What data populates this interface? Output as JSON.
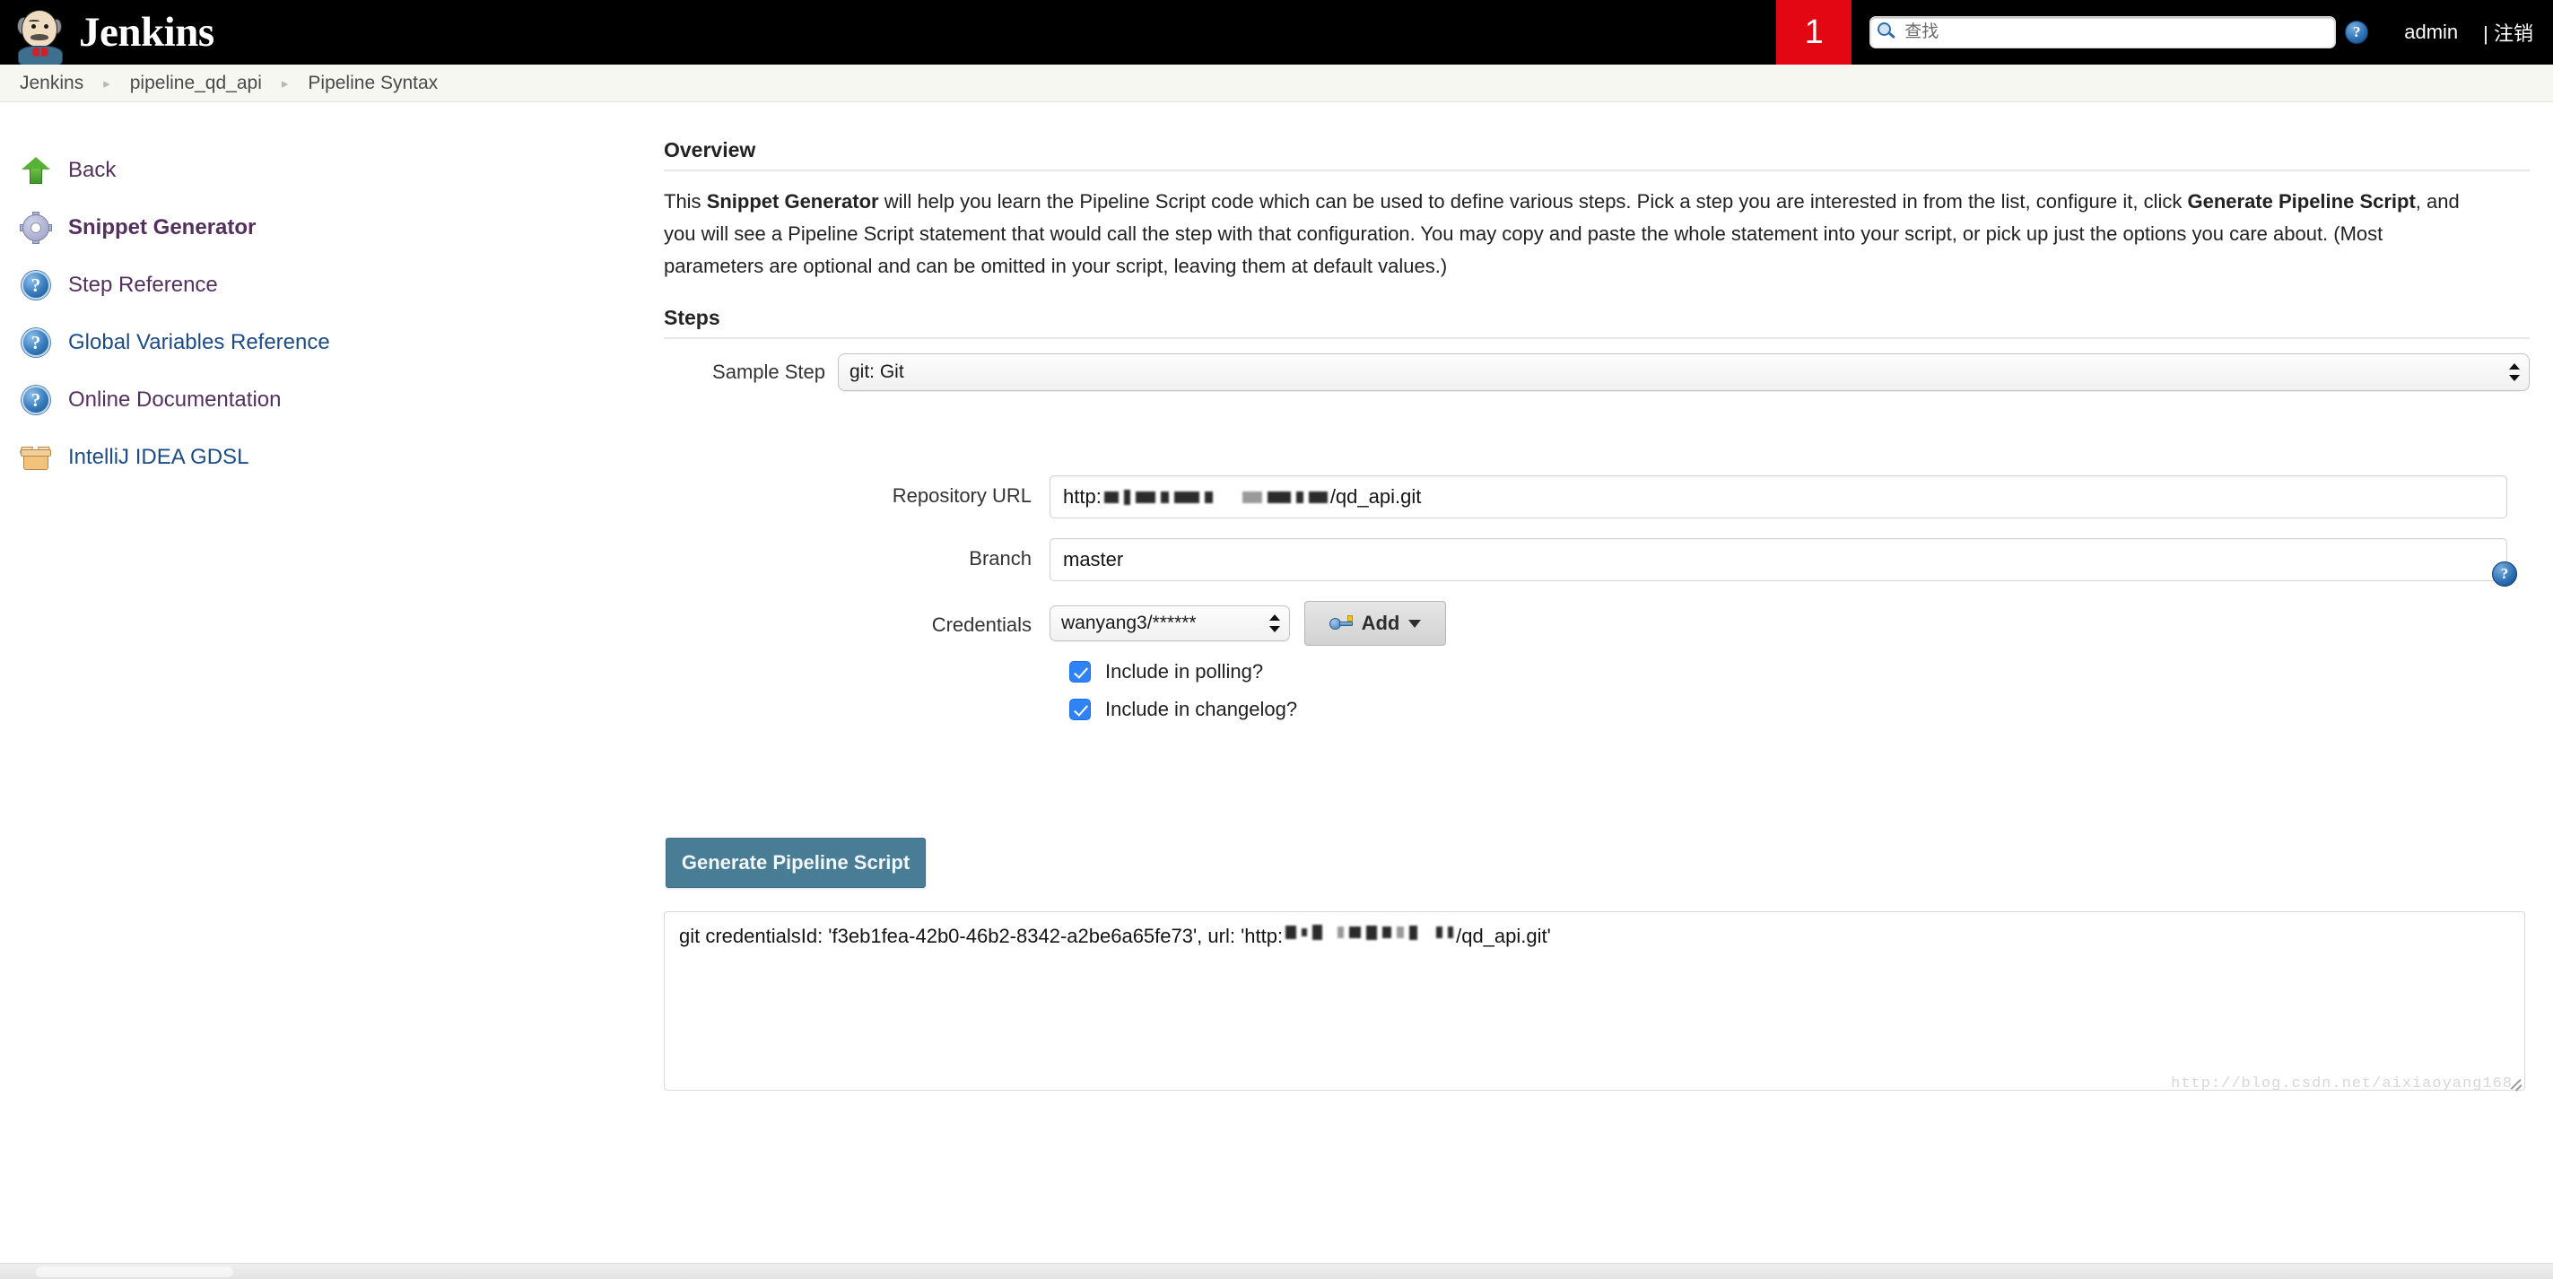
{
  "header": {
    "brand_text": "Jenkins",
    "alert_count": "1",
    "search_placeholder": "查找",
    "search_value": "",
    "help_glyph": "?",
    "user_name": "admin",
    "logout_label": "| 注销"
  },
  "breadcrumb": {
    "items": [
      {
        "label": "Jenkins"
      },
      {
        "label": "pipeline_qd_api"
      },
      {
        "label": "Pipeline Syntax"
      }
    ],
    "separator": "▸"
  },
  "sidebar": {
    "items": [
      {
        "label": "Back",
        "icon": "up-arrow-icon",
        "state": "visited"
      },
      {
        "label": "Snippet Generator",
        "icon": "gear-icon",
        "state": "current"
      },
      {
        "label": "Step Reference",
        "icon": "question-icon",
        "state": "visited"
      },
      {
        "label": "Global Variables Reference",
        "icon": "question-icon",
        "state": "link"
      },
      {
        "label": "Online Documentation",
        "icon": "question-icon",
        "state": "visited"
      },
      {
        "label": "IntelliJ IDEA GDSL",
        "icon": "box-icon",
        "state": "link"
      }
    ]
  },
  "main": {
    "overview_heading": "Overview",
    "overview_paragraph": {
      "p1": "This ",
      "b1": "Snippet Generator",
      "p2": " will help you learn the Pipeline Script code which can be used to define various steps. Pick a step you are interested in from the list, configure it, click ",
      "b2": "Generate Pipeline Script",
      "p3": ", and you will see a Pipeline Script statement that would call the step with that configuration. You may copy and paste the whole statement into your script, or pick up just the options you care about. (Most parameters are optional and can be omitted in your script, leaving them at default values.)"
    },
    "steps_heading": "Steps",
    "sample_step_label": "Sample Step",
    "sample_step_value": "git: Git",
    "help_glyph": "?",
    "form": {
      "repository_url_label": "Repository URL",
      "repository_url_prefix": "http:",
      "repository_url_suffix": "/qd_api.git",
      "branch_label": "Branch",
      "branch_value": "master",
      "credentials_label": "Credentials",
      "credentials_value": "wanyang3/******",
      "add_credentials_label": "Add",
      "polling_checkbox_label": "Include in polling?",
      "changelog_checkbox_label": "Include in changelog?"
    },
    "generate_button_label": "Generate Pipeline Script",
    "output": {
      "prefix": "git credentialsId: 'f3eb1fea-42b0-46b2-8342-a2be6a65fe73', url: 'http:",
      "suffix": "/qd_api.git'"
    },
    "watermark": "http://blog.csdn.net/aixiaoyang168"
  },
  "colors": {
    "header_bg": "#000000",
    "alert_badge": "#e30613",
    "link_blue": "#1c4c86",
    "link_visited": "#54305f",
    "primary_button": "#497d96",
    "checkbox_blue": "#2f83f6"
  }
}
